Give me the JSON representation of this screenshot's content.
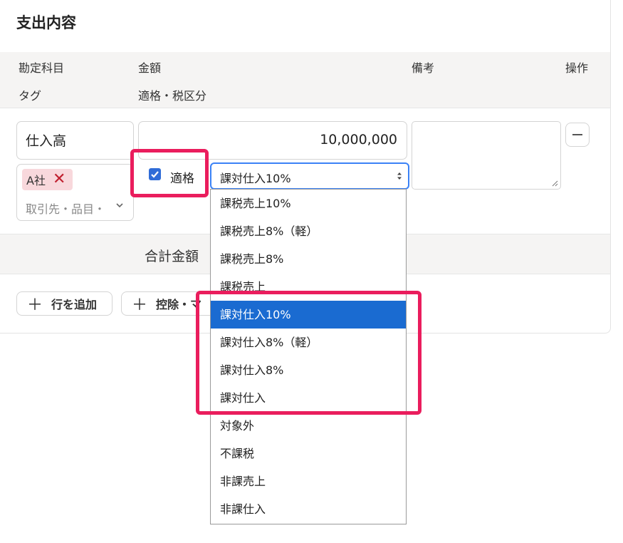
{
  "section": {
    "title": "支出内容"
  },
  "headers": {
    "account": "勘定科目",
    "amount": "金額",
    "note": "備考",
    "action": "操作",
    "tag": "タグ",
    "tax": "適格・税区分"
  },
  "row": {
    "account": "仕入高",
    "amount": "10,000,000",
    "tag_chip": "A社",
    "tag_placeholder": "取引先・品目・",
    "qualified_label": "適格",
    "qualified_checked": true,
    "tax_selected": "課対仕入10%"
  },
  "summary": {
    "label": "合計金額"
  },
  "actions": {
    "add_row": "行を追加",
    "deduct": "控除・マ"
  },
  "dropdown": {
    "options": [
      "課税売上10%",
      "課税売上8%（軽）",
      "課税売上8%",
      "課税売上",
      "課対仕入10%",
      "課対仕入8%（軽）",
      "課対仕入8%",
      "課対仕入",
      "対象外",
      "不課税",
      "非課売上",
      "非課仕入"
    ],
    "selected_index": 4
  },
  "colors": {
    "accent": "#1a6bd1",
    "highlight": "#ea1d5d",
    "tag_bg": "#f8d8dc"
  }
}
